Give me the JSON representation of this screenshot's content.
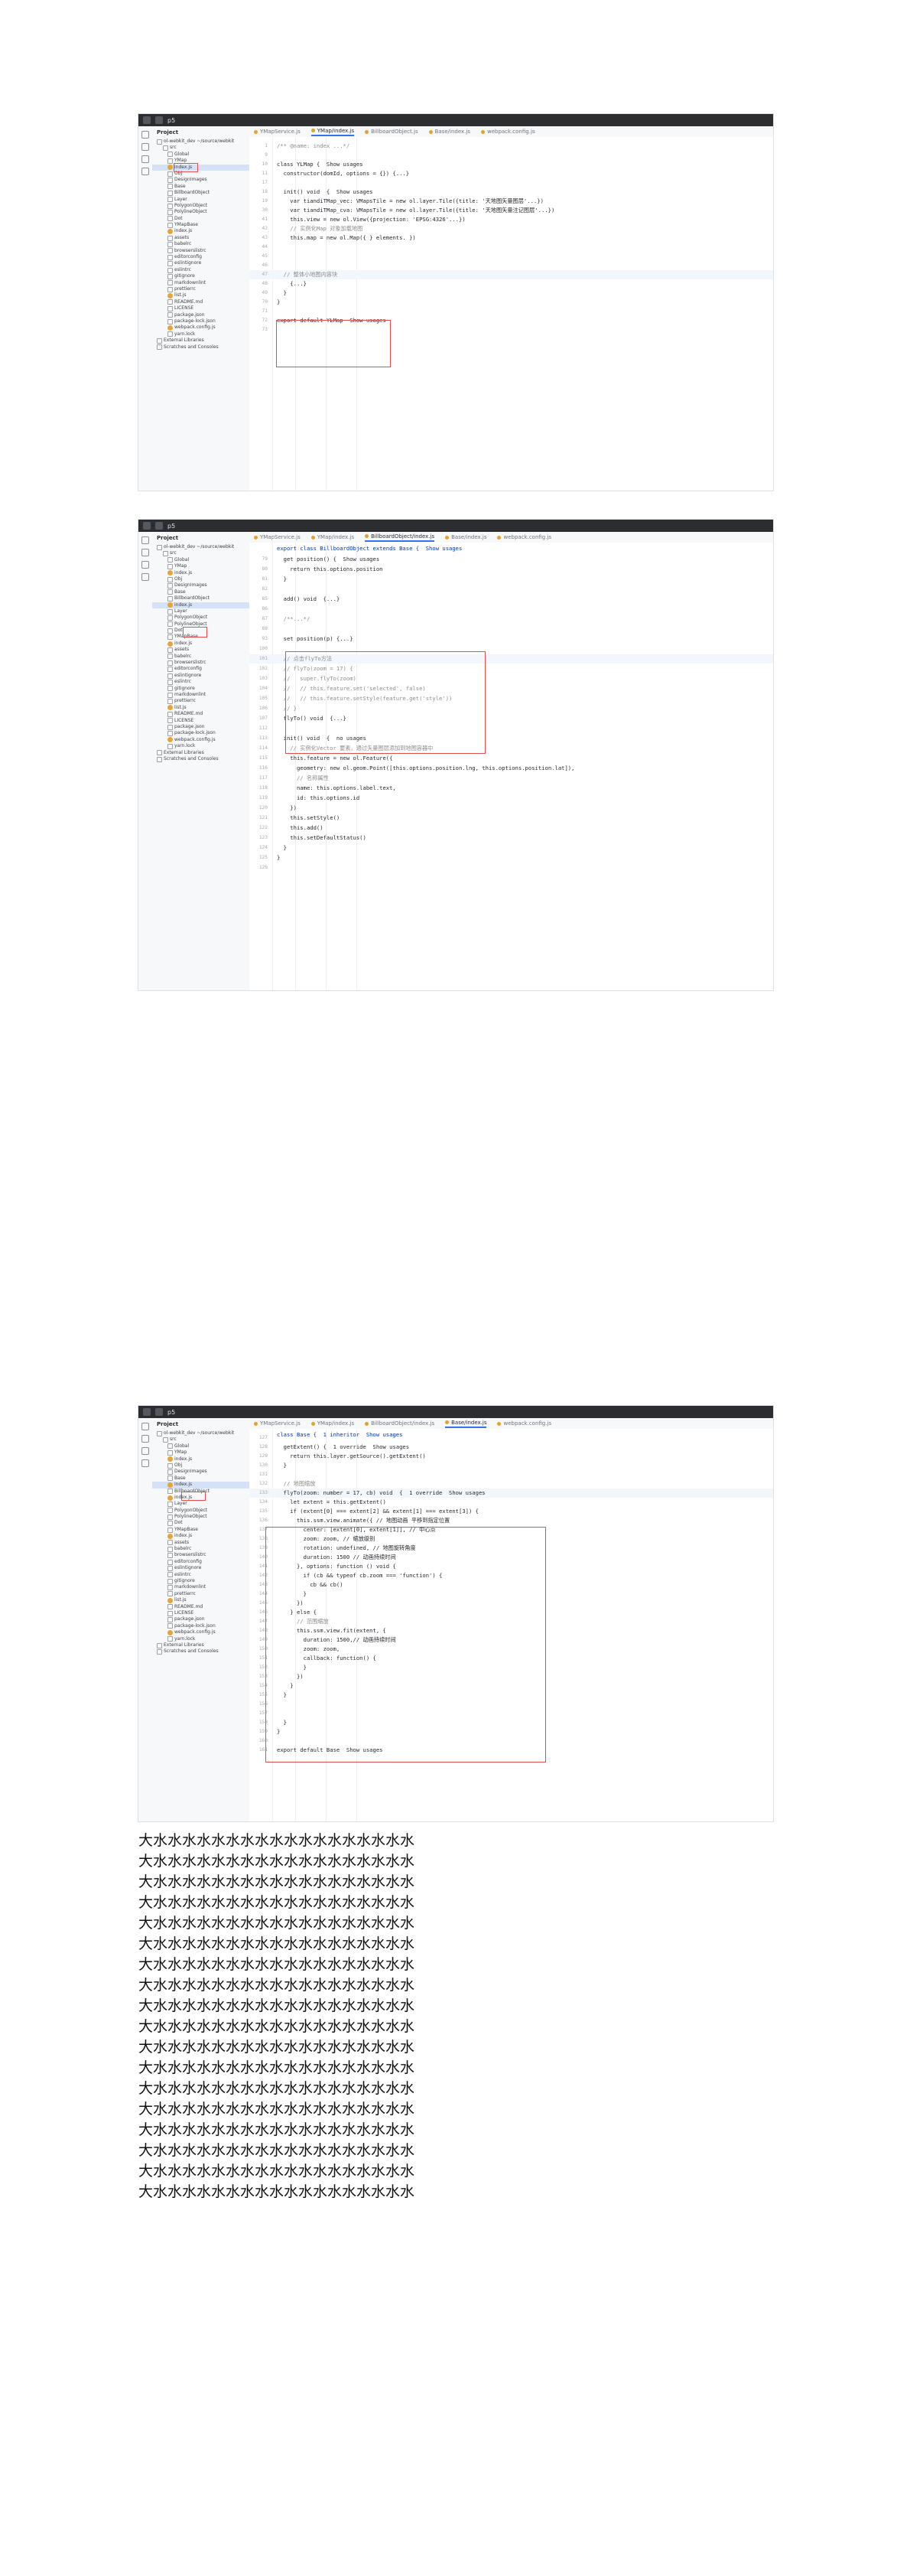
{
  "screens": [
    {
      "project_label": "p5",
      "panel_title": "Project",
      "tabs": [
        "YMapService.js",
        "YMap/index.js",
        "BillboardObject.js",
        "Base/index.js",
        "webpack.config.js"
      ],
      "active_tab": 1,
      "tree": [
        "ol-webkit_dev  ~/source/webkit",
        "src",
        "Global",
        "YMap",
        "index.js",
        "Obj",
        "DesignImages",
        "Base",
        "BillboardObject",
        "Layer",
        "PolygonObject",
        "PolylineObject",
        "Dot",
        "YMapBase",
        "index.js",
        "assets",
        "babelrc",
        "browserslistrc",
        "editorconfig",
        "eslintignore",
        "eslintrc",
        "gitignore",
        "markdownlint",
        "prettierrc",
        "list.js",
        "README.md",
        "LICENSE",
        "package.json",
        "package-lock.json",
        "webpack.config.js",
        "yarn.lock",
        "External Libraries",
        "Scratches and Consoles"
      ],
      "selected_tree": 4,
      "code": [
        {
          "n": "1",
          "t": "/** @name: index ...*/"
        },
        {
          "n": "9",
          "t": ""
        },
        {
          "n": "10",
          "t": "class YLMap {  Show usages"
        },
        {
          "n": "11",
          "t": "  constructor(domId, options = {}) {...}"
        },
        {
          "n": "17",
          "t": ""
        },
        {
          "n": "18",
          "t": "  init() void  {  Show usages"
        },
        {
          "n": "19",
          "t": "    var tiandiTMap_vec: VMapsTile = new ol.layer.Tile({title: '天地图矢量图层'...})"
        },
        {
          "n": "30",
          "t": "    var tiandiTMap_cva: VMapsTile = new ol.layer.Tile({title: '天地图矢量注记图层'...})"
        },
        {
          "n": "41",
          "t": "    this.view = new ol.View({projection: 'EPSG:4326'...})"
        },
        {
          "n": "42",
          "t": "    // 实例化Map 对象加载地图"
        },
        {
          "n": "43",
          "t": "    this.map = new ol.Map({ } elements. })"
        },
        {
          "n": "44",
          "t": ""
        },
        {
          "n": "45",
          "t": ""
        },
        {
          "n": "46",
          "t": ""
        },
        {
          "n": "47",
          "t": "  // 整体小地图内容块"
        },
        {
          "n": "48",
          "t": "    {...}"
        },
        {
          "n": "49",
          "t": "  }"
        },
        {
          "n": "70",
          "t": "}"
        },
        {
          "n": "71",
          "t": ""
        },
        {
          "n": "72",
          "t": "export default YLMap  Show usages"
        },
        {
          "n": "73",
          "t": ""
        }
      ],
      "highlight_line": 14
    },
    {
      "project_label": "p5",
      "panel_title": "Project",
      "tabs": [
        "YMapService.js",
        "YMap/index.js",
        "BillboardObject/index.js",
        "Base/index.js",
        "webpack.config.js"
      ],
      "active_tab": 2,
      "tree": [
        "ol-webkit_dev  ~/source/webkit",
        "src",
        "Global",
        "YMap",
        "index.js",
        "Obj",
        "DesignImages",
        "Base",
        "BillboardObject",
        "index.js",
        "Layer",
        "PolygonObject",
        "PolylineObject",
        "Dot",
        "YMapBase",
        "index.js",
        "assets",
        "babelrc",
        "browserslistrc",
        "editorconfig",
        "eslintignore",
        "eslintrc",
        "gitignore",
        "markdownlint",
        "prettierrc",
        "list.js",
        "README.md",
        "LICENSE",
        "package.json",
        "package-lock.json",
        "webpack.config.js",
        "yarn.lock",
        "External Libraries",
        "Scratches and Consoles"
      ],
      "selected_tree": 9,
      "breadcrumb": "export class BillboardObject extends Base {  Show usages",
      "code": [
        {
          "n": "79",
          "t": "  get position() {  Show usages"
        },
        {
          "n": "80",
          "t": "    return this.options.position"
        },
        {
          "n": "81",
          "t": "  }"
        },
        {
          "n": "82",
          "t": ""
        },
        {
          "n": "85",
          "t": "  add() void  {...}"
        },
        {
          "n": "86",
          "t": ""
        },
        {
          "n": "87",
          "t": "  /**...*/"
        },
        {
          "n": "88",
          "t": ""
        },
        {
          "n": "93",
          "t": "  set position(p) {...}"
        },
        {
          "n": "100",
          "t": ""
        },
        {
          "n": "101",
          "t": "  // 点击flyTo方法"
        },
        {
          "n": "102",
          "t": "  // flyTo(zoom = 17) {"
        },
        {
          "n": "103",
          "t": "  //   super.flyTo(zoom)"
        },
        {
          "n": "104",
          "t": "  //   // this.feature.set('selected', false)"
        },
        {
          "n": "105",
          "t": "  //   // this.feature.setStyle(feature.get('style'))"
        },
        {
          "n": "106",
          "t": "  // }"
        },
        {
          "n": "107",
          "t": "  flyTo() void  {...}"
        },
        {
          "n": "112",
          "t": ""
        },
        {
          "n": "113",
          "t": "  init() void  {  no usages"
        },
        {
          "n": "114",
          "t": "    // 实例化Vector 要素，通过矢量图层添加到地图容器中"
        },
        {
          "n": "115",
          "t": "    this.feature = new ol.Feature({"
        },
        {
          "n": "116",
          "t": "      geometry: new ol.geom.Point([this.options.position.lng, this.options.position.lat]),"
        },
        {
          "n": "117",
          "t": "      // 名称属性"
        },
        {
          "n": "118",
          "t": "      name: this.options.label.text,"
        },
        {
          "n": "119",
          "t": "      id: this.options.id"
        },
        {
          "n": "120",
          "t": "    })"
        },
        {
          "n": "121",
          "t": "    this.setStyle()"
        },
        {
          "n": "122",
          "t": "    this.add()"
        },
        {
          "n": "123",
          "t": "    this.setDefaultStatus()"
        },
        {
          "n": "124",
          "t": "  }"
        },
        {
          "n": "125",
          "t": "}"
        },
        {
          "n": "126",
          "t": ""
        }
      ],
      "highlight_line": 10
    },
    {
      "project_label": "p5",
      "panel_title": "Project",
      "tabs": [
        "YMapService.js",
        "YMap/index.js",
        "BillboardObject/index.js",
        "Base/index.js",
        "webpack.config.js"
      ],
      "active_tab": 3,
      "tree": [
        "ol-webkit_dev  ~/source/webkit",
        "src",
        "Global",
        "YMap",
        "index.js",
        "Obj",
        "DesignImages",
        "Base",
        "index.js",
        "BillboardObject",
        "index.js",
        "Layer",
        "PolygonObject",
        "PolylineObject",
        "Dot",
        "YMapBase",
        "index.js",
        "assets",
        "babelrc",
        "browserslistrc",
        "editorconfig",
        "eslintignore",
        "eslintrc",
        "gitignore",
        "markdownlint",
        "prettierrc",
        "list.js",
        "README.md",
        "LICENSE",
        "package.json",
        "package-lock.json",
        "webpack.config.js",
        "yarn.lock",
        "External Libraries",
        "Scratches and Consoles"
      ],
      "selected_tree": 8,
      "breadcrumb": "class Base {  1 inheritor  Show usages",
      "code": [
        {
          "n": "127",
          "t": ""
        },
        {
          "n": "128",
          "t": "  getExtent() {  1 override  Show usages"
        },
        {
          "n": "129",
          "t": "    return this.layer.getSource().getExtent()"
        },
        {
          "n": "130",
          "t": "  }"
        },
        {
          "n": "131",
          "t": ""
        },
        {
          "n": "132",
          "t": "  // 地图缩放"
        },
        {
          "n": "133",
          "t": "  flyTo(zoom: number = 17, cb) void  {  1 override  Show usages"
        },
        {
          "n": "134",
          "t": "    let extent = this.getExtent()"
        },
        {
          "n": "135",
          "t": "    if (extent[0] === extent[2] && extent[1] === extent[3]) {"
        },
        {
          "n": "136",
          "t": "      this.ssm.view.animate({ // 地图动画 平移到指定位置"
        },
        {
          "n": "137",
          "t": "        center: [extent[0], extent[1]], // 中心点"
        },
        {
          "n": "138",
          "t": "        zoom: zoom, // 缩放级别"
        },
        {
          "n": "139",
          "t": "        rotation: undefined, // 地图旋转角度"
        },
        {
          "n": "140",
          "t": "        duration: 1500 // 动画持续时间"
        },
        {
          "n": "141",
          "t": "      }, options: function () void {"
        },
        {
          "n": "142",
          "t": "        if (cb && typeof cb.zoom === 'function') {"
        },
        {
          "n": "143",
          "t": "          cb && cb()"
        },
        {
          "n": "144",
          "t": "        }"
        },
        {
          "n": "145",
          "t": "      })"
        },
        {
          "n": "146",
          "t": "    } else {"
        },
        {
          "n": "147",
          "t": "      // 范围缩放"
        },
        {
          "n": "148",
          "t": "      this.ssm.view.fit(extent, {"
        },
        {
          "n": "149",
          "t": "        duration: 1500,// 动画持续时间"
        },
        {
          "n": "150",
          "t": "        zoom: zoom,"
        },
        {
          "n": "151",
          "t": "        callback: function() {"
        },
        {
          "n": "152",
          "t": "        }"
        },
        {
          "n": "153",
          "t": "      })"
        },
        {
          "n": "154",
          "t": "    }"
        },
        {
          "n": "155",
          "t": "  }"
        },
        {
          "n": "156",
          "t": ""
        },
        {
          "n": "157",
          "t": ""
        },
        {
          "n": "158",
          "t": "  }"
        },
        {
          "n": "159",
          "t": "}"
        },
        {
          "n": "160",
          "t": ""
        },
        {
          "n": "161",
          "t": "export default Base  Show usages"
        }
      ],
      "highlight_line": 6
    }
  ],
  "repeated_text": [
    "大水水水水水水水水水水水水水水水水水水",
    "大水水水水水水水水水水水水水水水水水水",
    "大水水水水水水水水水水水水水水水水水水",
    "大水水水水水水水水水水水水水水水水水水",
    "大水水水水水水水水水水水水水水水水水水",
    "大水水水水水水水水水水水水水水水水水水",
    "大水水水水水水水水水水水水水水水水水水",
    "大水水水水水水水水水水水水水水水水水水",
    "大水水水水水水水水水水水水水水水水水水",
    "大水水水水水水水水水水水水水水水水水水",
    "大水水水水水水水水水水水水水水水水水水",
    "大水水水水水水水水水水水水水水水水水水",
    "大水水水水水水水水水水水水水水水水水水",
    "大水水水水水水水水水水水水水水水水水水",
    "大水水水水水水水水水水水水水水水水水水",
    "大水水水水水水水水水水水水水水水水水水",
    "大水水水水水水水水水水水水水水水水水水",
    "大水水水水水水水水水水水水水水水水水水"
  ],
  "colors": {
    "accent": "#3574f0",
    "annotation_red": "#e34d4d",
    "titlebar": "#2b2d30"
  }
}
